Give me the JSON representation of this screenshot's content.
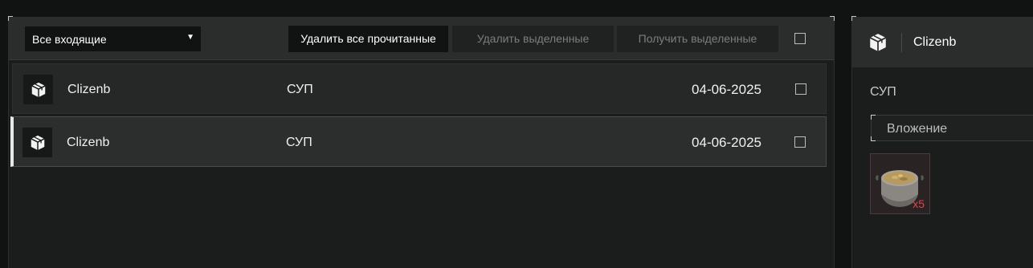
{
  "toolbar": {
    "filter_value": "Все входящие",
    "delete_read_label": "Удалить все прочитанные",
    "delete_selected_label": "Удалить выделенные",
    "receive_selected_label": "Получить выделенные"
  },
  "mails": [
    {
      "sender": "Clizenb",
      "subject": "СУП",
      "date": "04-06-2025",
      "selected": false
    },
    {
      "sender": "Clizenb",
      "subject": "СУП",
      "date": "04-06-2025",
      "selected": true
    }
  ],
  "detail": {
    "sender": "Clizenb",
    "subject": "СУП",
    "attachment_label": "Вложение",
    "item": {
      "icon": "soup-pot-icon",
      "count": "x5"
    }
  },
  "colors": {
    "item_count": "#e0444a",
    "selected_marker": "#e8e8e8"
  }
}
